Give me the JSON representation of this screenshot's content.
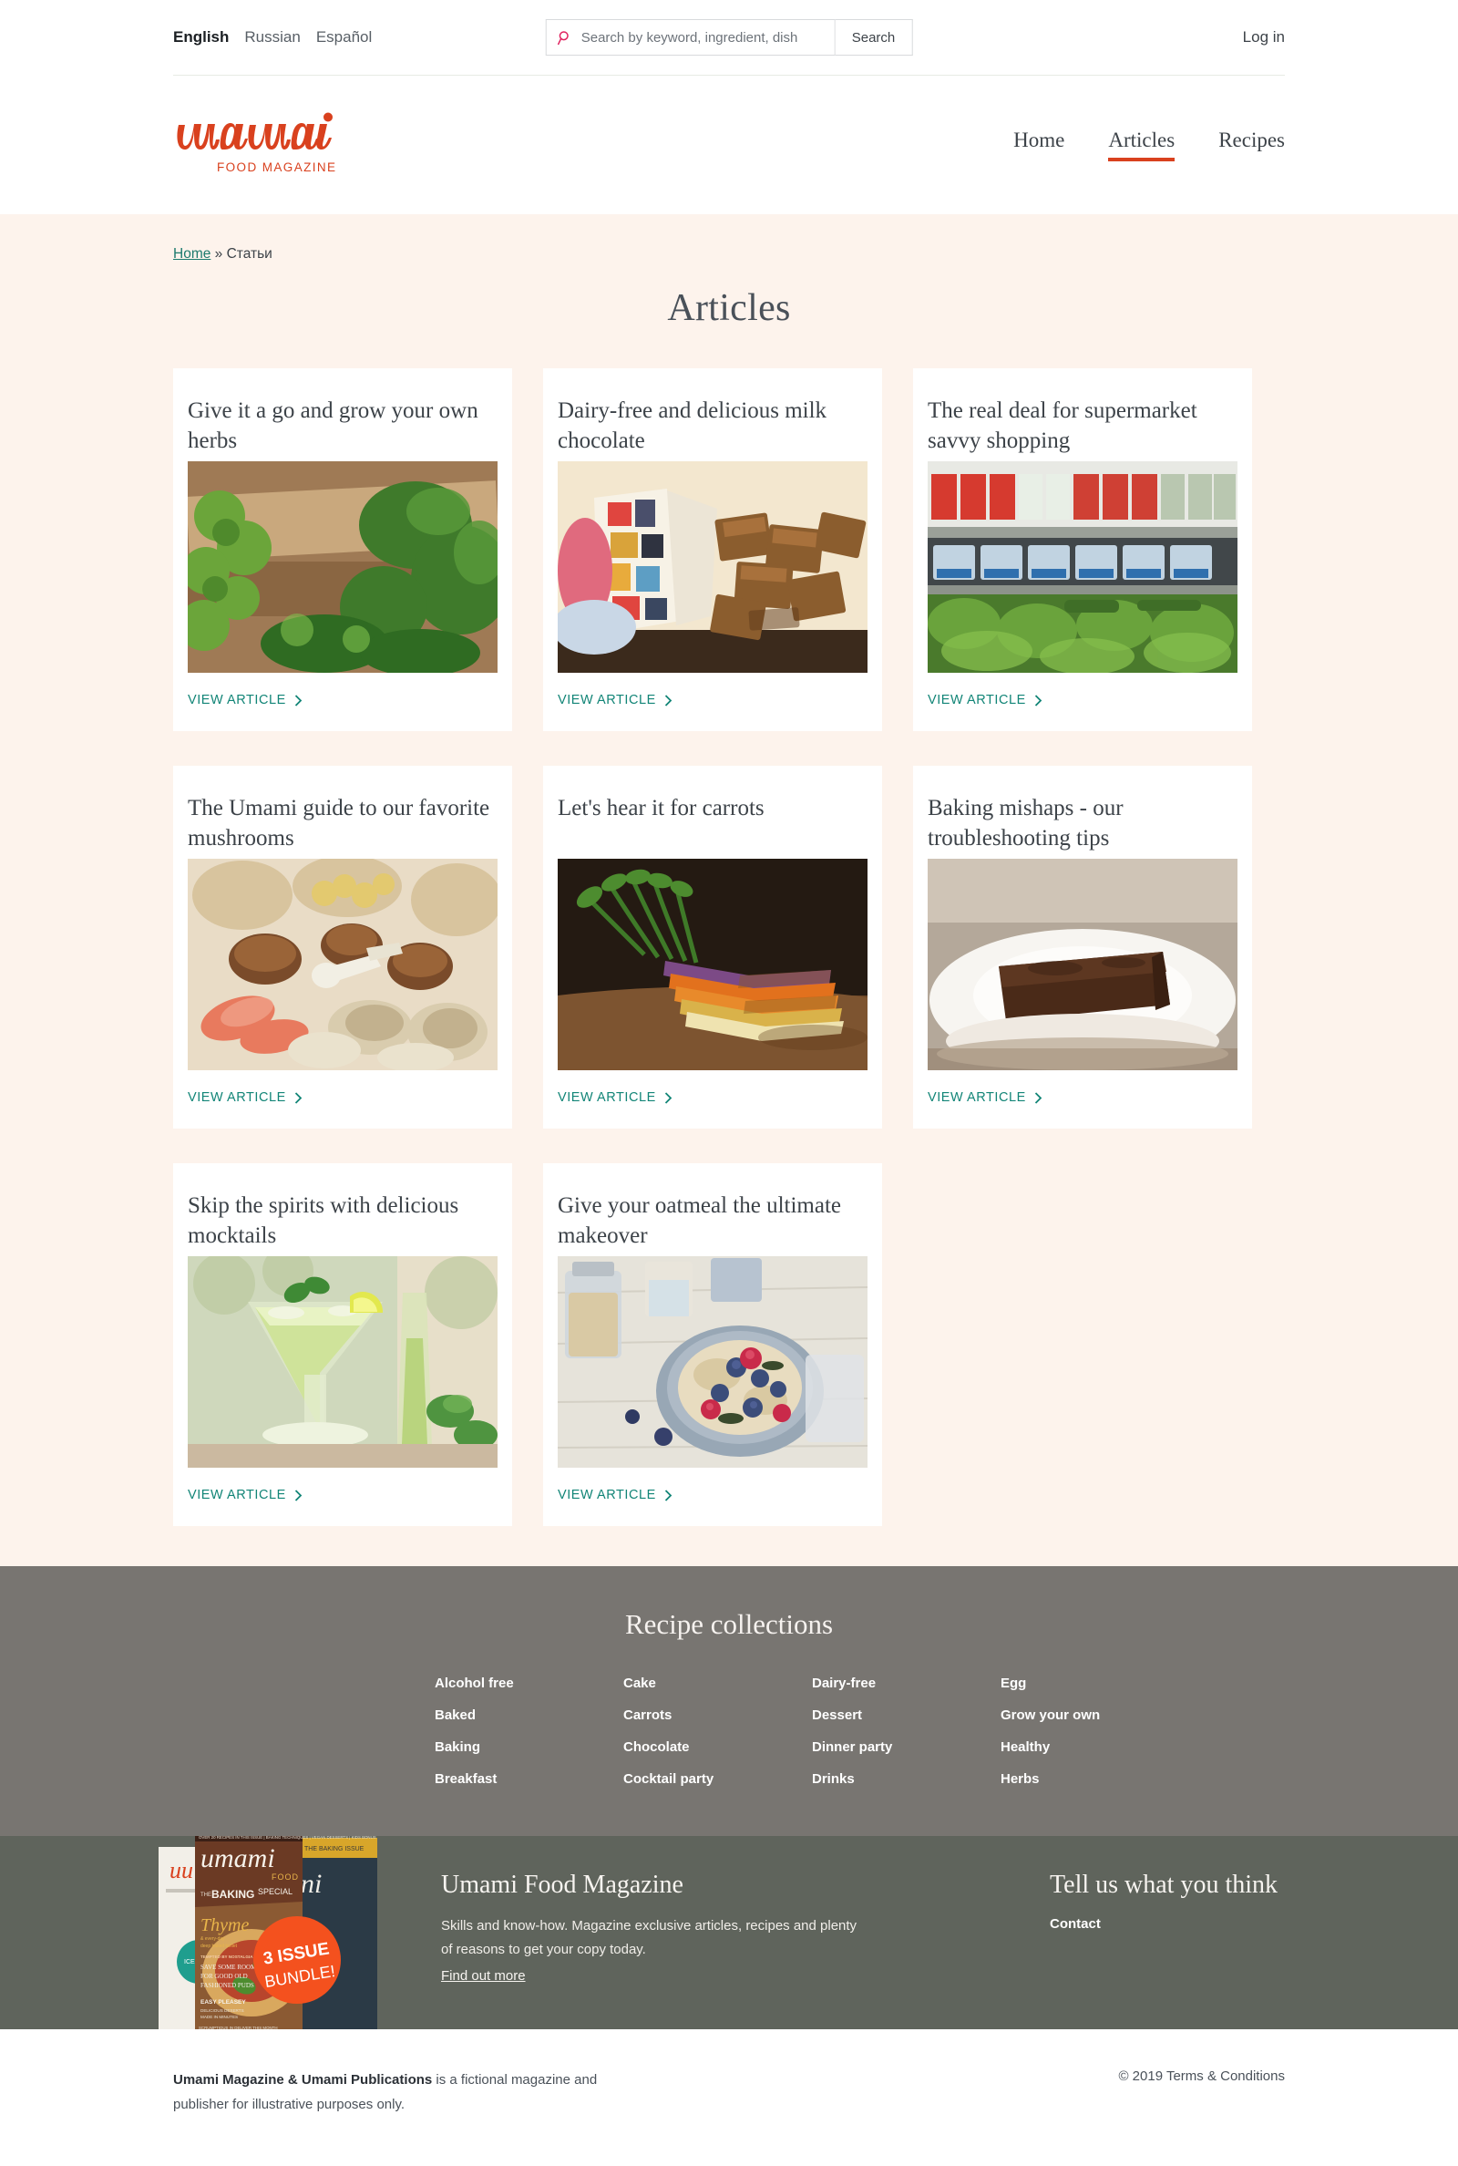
{
  "utility": {
    "languages": [
      {
        "label": "English",
        "active": true
      },
      {
        "label": "Russian",
        "active": false
      },
      {
        "label": "Español",
        "active": false
      }
    ],
    "search": {
      "icon": "search-icon",
      "placeholder": "Search by keyword, ingredient, dish",
      "value": "",
      "button_label": "Search"
    },
    "login_label": "Log in"
  },
  "masthead": {
    "logo": {
      "wordmark": "umami",
      "tagline": "FOOD MAGAZINE",
      "color": "#d9411e"
    },
    "nav": [
      {
        "label": "Home",
        "current": false
      },
      {
        "label": "Articles",
        "current": true
      },
      {
        "label": "Recipes",
        "current": false
      }
    ]
  },
  "page": {
    "breadcrumb": {
      "home_label": "Home",
      "separator": "»",
      "current_label": "Статьи"
    },
    "title": "Articles",
    "background": "#fdf3ec"
  },
  "articles": {
    "cta_label": "VIEW ARTICLE",
    "cta_color": "#128577",
    "items": [
      {
        "title": "Give it a go and grow your own herbs",
        "image": "herbs-on-wooden-board-photo"
      },
      {
        "title": "Dairy-free and delicious milk chocolate",
        "image": "milk-chocolate-chunks-photo"
      },
      {
        "title": "The real deal for supermarket savvy shopping",
        "image": "supermarket-produce-shelves-photo"
      },
      {
        "title": "The Umami guide to our favorite mushrooms",
        "image": "assorted-mushrooms-photo"
      },
      {
        "title": "Let's hear it for carrots",
        "image": "heirloom-carrots-photo"
      },
      {
        "title": "Baking mishaps - our troubleshooting tips",
        "image": "chocolate-brownie-on-plate-photo"
      },
      {
        "title": "Skip the spirits with delicious mocktails",
        "image": "mint-lime-mocktail-photo"
      },
      {
        "title": "Give your oatmeal the ultimate makeover",
        "image": "oatmeal-berries-bowl-photo"
      }
    ]
  },
  "collections": {
    "title": "Recipe collections",
    "columns": [
      [
        "Alcohol free",
        "Baked",
        "Baking",
        "Breakfast"
      ],
      [
        "Cake",
        "Carrots",
        "Chocolate",
        "Cocktail party"
      ],
      [
        "Dairy-free",
        "Dessert",
        "Dinner party",
        "Drinks"
      ],
      [
        "Egg",
        "Grow your own",
        "Healthy",
        "Herbs"
      ]
    ]
  },
  "promo": {
    "art": {
      "badge_line1": "3 ISSUE",
      "badge_line2": "BUNDLE!",
      "badge_color": "#f4511e",
      "cover_wordmark": "umami",
      "cover_sub": "FOOD",
      "cover_kicker": "THE BAKING SPECIAL",
      "cover_feature": "Thyme"
    },
    "heading": "Umami Food Magazine",
    "description": "Skills and know-how. Magazine exclusive articles, recipes and plenty of reasons to get your copy today.",
    "link_label": "Find out more",
    "right_heading": "Tell us what you think",
    "contact_label": "Contact"
  },
  "colophon": {
    "bold_text": "Umami Magazine & Umami Publications",
    "rest_text": " is a fictional magazine and publisher for illustrative purposes only.",
    "terms": "© 2019 Terms & Conditions"
  }
}
